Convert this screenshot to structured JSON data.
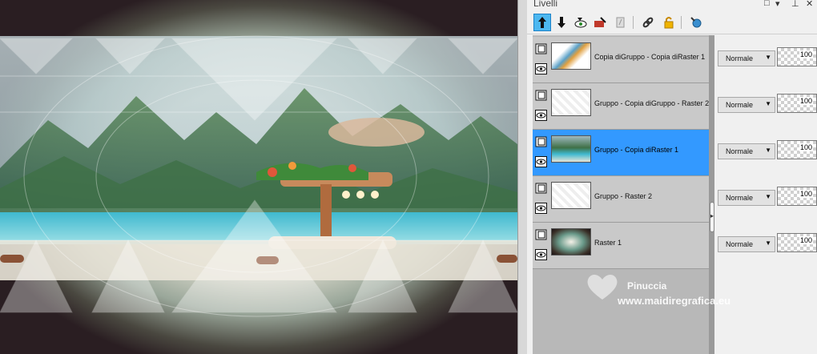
{
  "panel": {
    "title": "Livelli",
    "window_controls": [
      "□",
      "▾",
      "⊥",
      "✕"
    ]
  },
  "toolbar": {
    "tools": [
      {
        "icon": "new-raster-layer-icon",
        "active": true
      },
      {
        "icon": "new-vector-layer-icon",
        "active": false
      },
      {
        "icon": "new-mask-layer-icon",
        "active": false
      },
      {
        "icon": "new-adjustment-layer-icon",
        "active": false
      },
      {
        "icon": "duplicate-layer-icon",
        "active": false
      },
      {
        "icon": "link-layer-icon",
        "active": false
      },
      {
        "icon": "lock-layer-icon",
        "active": false
      },
      {
        "icon": "delete-layer-icon",
        "active": false
      }
    ]
  },
  "layers": [
    {
      "name": "Copia diGruppo - Copia diRaster 1",
      "blend_mode": "Normale",
      "opacity": "100",
      "selected": false
    },
    {
      "name": "Gruppo - Copia diGruppo - Raster 2",
      "blend_mode": "Normale",
      "opacity": "100",
      "selected": false
    },
    {
      "name": "Gruppo - Copia diRaster 1",
      "blend_mode": "Normale",
      "opacity": "100",
      "selected": true
    },
    {
      "name": "Gruppo - Raster 2",
      "blend_mode": "Normale",
      "opacity": "100",
      "selected": false
    },
    {
      "name": "Raster 1",
      "blend_mode": "Normale",
      "opacity": "100",
      "selected": false
    }
  ],
  "watermark": {
    "name": "Pinuccia",
    "url": "www.maidiregrafica.eu"
  },
  "colors": {
    "selected_row": "#3399ff",
    "row_bg": "#c9c9c9",
    "active_tool": "#4db8f0"
  }
}
